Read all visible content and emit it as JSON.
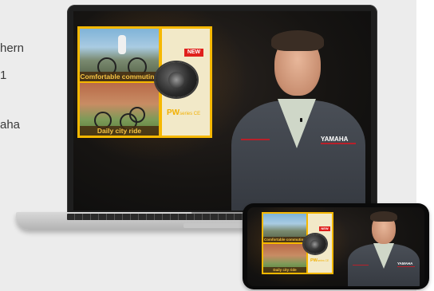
{
  "side_text": {
    "line1": "hern",
    "line2": "1",
    "line3": "aha"
  },
  "laptop_slide": {
    "caption_top": "Comfortable commuting",
    "caption_bottom": "Daily city ride",
    "badge": "NEW",
    "product_main": "PW",
    "product_sub": "series CE"
  },
  "laptop_presenter": {
    "brand": "YAMAHA"
  },
  "phone_slide": {
    "caption_top": "Comfortable commuting",
    "caption_bottom": "Daily city ride",
    "badge": "NEW",
    "product_main": "PW",
    "product_sub": "series CE"
  },
  "phone_presenter": {
    "brand": "YAMAHA"
  },
  "colors": {
    "accent": "#f6b800",
    "badge": "#e0201c",
    "background": "#ececec"
  }
}
